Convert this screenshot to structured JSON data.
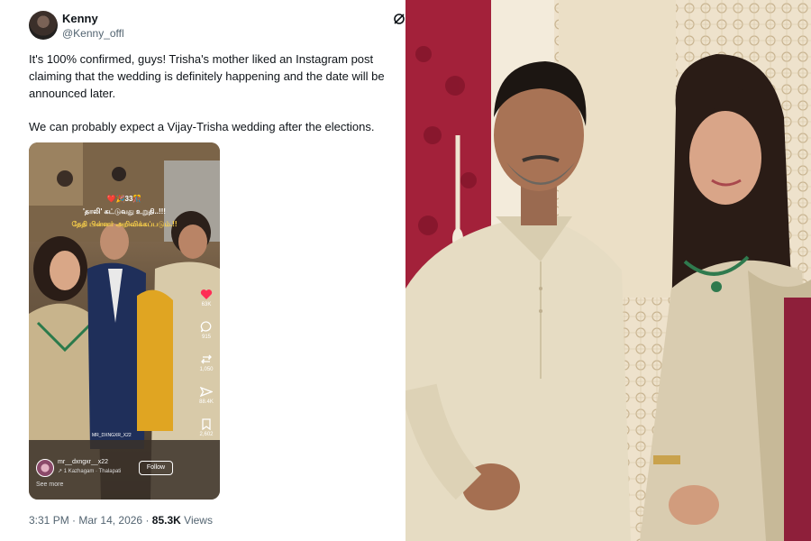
{
  "tweet": {
    "display_name": "Kenny",
    "handle": "@Kenny_offl",
    "text_lines": [
      "It's 100% confirmed, guys! Trisha's mother liked an Instagram post",
      "claiming that the wedding is definitely happening and the date will be",
      "announced later.",
      "We can probably expect a Vijay-Trisha wedding after the elections."
    ],
    "time": "3:31 PM",
    "separator": "·",
    "date": "Mar 14, 2026",
    "views_count": "85.3K",
    "views_label": "Views"
  },
  "video": {
    "overlay_lines": [
      "❤️🎉33🎊",
      "'தாலி' கட்டுவது உறுதி..!!!",
      "தேதி பின்னர் அறிவிக்கப்படும்.!!"
    ],
    "actions": [
      {
        "icon": "heart-icon",
        "count": "63K"
      },
      {
        "icon": "comment-icon",
        "count": "915"
      },
      {
        "icon": "repost-icon",
        "count": "1,050"
      },
      {
        "icon": "share-icon",
        "count": "88.4K"
      },
      {
        "icon": "bookmark-icon",
        "count": "2,602"
      }
    ],
    "music_tag": "MR_DXNGXR_X22",
    "creator_name": "mr__dxngxr__x22",
    "creator_sub": "↗ 1 Kazhagam · Thalapati",
    "follow_label": "Follow",
    "see_more": "See more"
  },
  "colors": {
    "accent_heart": "#ff2d55",
    "muted_text": "#536471",
    "body_text": "#0f1419",
    "kurta": "#e6dcc3",
    "saree": "#d9ccb0",
    "backdrop_red": "#a3213a"
  }
}
